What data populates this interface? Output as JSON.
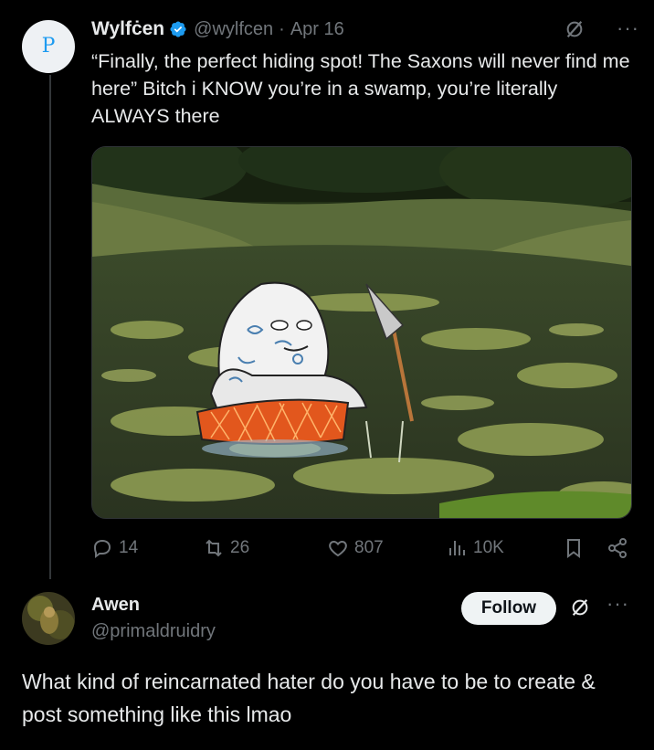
{
  "tweet": {
    "avatar_letter": "P",
    "name": "Wylfċen",
    "handle": "@wylfcen",
    "separator": "·",
    "date": "Apr 16",
    "more": "···",
    "text": "“Finally, the perfect hiding spot! The Saxons will never find me here” Bitch i KNOW you’re in a swamp, you’re literally ALWAYS there",
    "media_description_icon": "swamp-meme-image",
    "stats": {
      "replies": "14",
      "reposts": "26",
      "likes": "807",
      "views": "10K"
    }
  },
  "reply": {
    "name": "Awen",
    "handle": "@primaldruidry",
    "follow_label": "Follow",
    "more": "···",
    "text": "What kind of reincarnated hater do you have to be to create & post something like this lmao"
  },
  "colors": {
    "background": "#000000",
    "text": "#e7e9ea",
    "muted": "#71767b",
    "verified": "#1d9bf0",
    "follow_bg": "#eff3f4"
  }
}
